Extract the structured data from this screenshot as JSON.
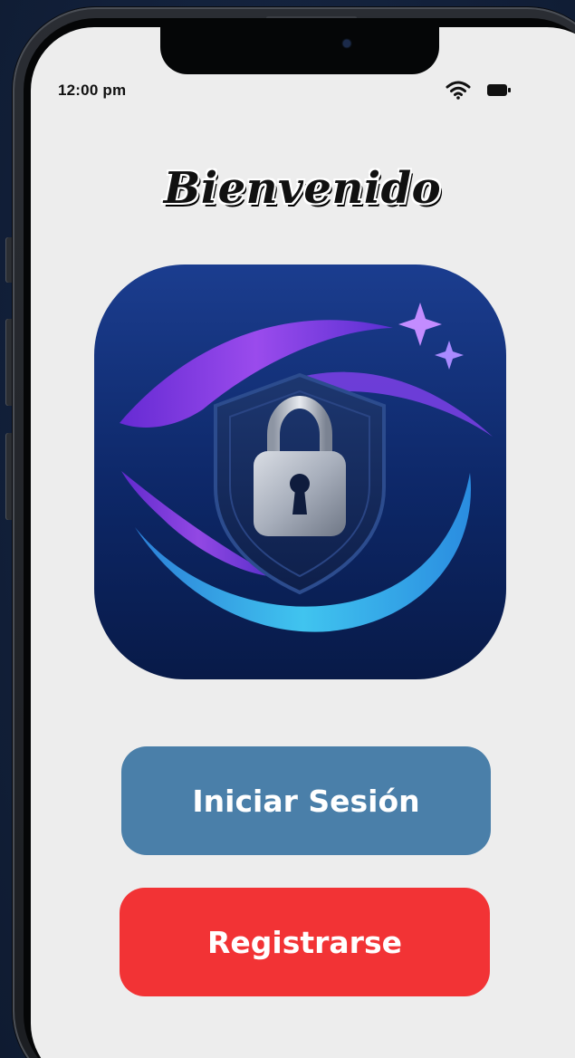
{
  "status_bar": {
    "time": "12:00 pm",
    "wifi_icon": "wifi-icon",
    "battery_icon": "battery-icon"
  },
  "welcome": {
    "title": "Bienvenido"
  },
  "app_icon": {
    "icon": "shield-lock-icon",
    "colors": {
      "background": "#0f2a6b",
      "purple": "#8a3cf0",
      "cyan": "#3bb6ea"
    }
  },
  "actions": {
    "login_label": "Iniciar Sesión",
    "register_label": "Registrarse"
  },
  "colors": {
    "screen_bg": "#ededed",
    "login_button": "#4a7fa9",
    "register_button": "#f23335",
    "page_bg": "#14233a"
  }
}
